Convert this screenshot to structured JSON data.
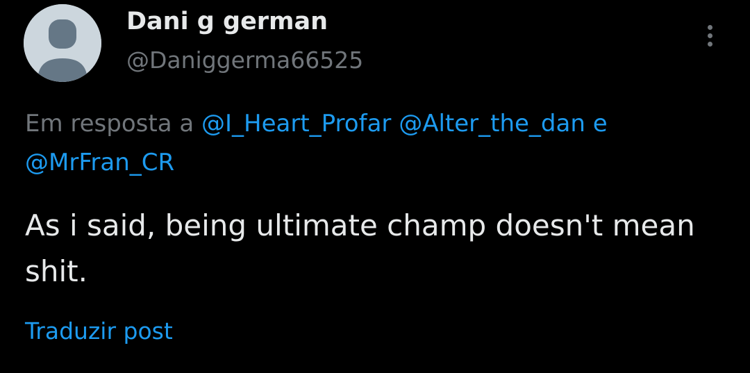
{
  "post": {
    "author": {
      "display_name": "Dani g german",
      "handle": "@Daniggerma66525",
      "avatar_icon": "default-profile-avatar-icon"
    },
    "more_icon": "more-options-icon",
    "reply_context": {
      "prefix": "Em resposta a ",
      "mentions": [
        "@I_Heart_Profar",
        "@Alter_the_dan",
        "@MrFran_CR"
      ],
      "separator_1": " ",
      "separator_2": " e "
    },
    "text": "As i said, being ultimate champ doesn't mean shit.",
    "translate_label": "Traduzir post"
  },
  "colors": {
    "background": "#000000",
    "primary_text": "#e7e9ea",
    "secondary_text": "#71767b",
    "link": "#1d9bf0",
    "avatar_bg": "#ccd6dd",
    "avatar_fg": "#657786"
  }
}
